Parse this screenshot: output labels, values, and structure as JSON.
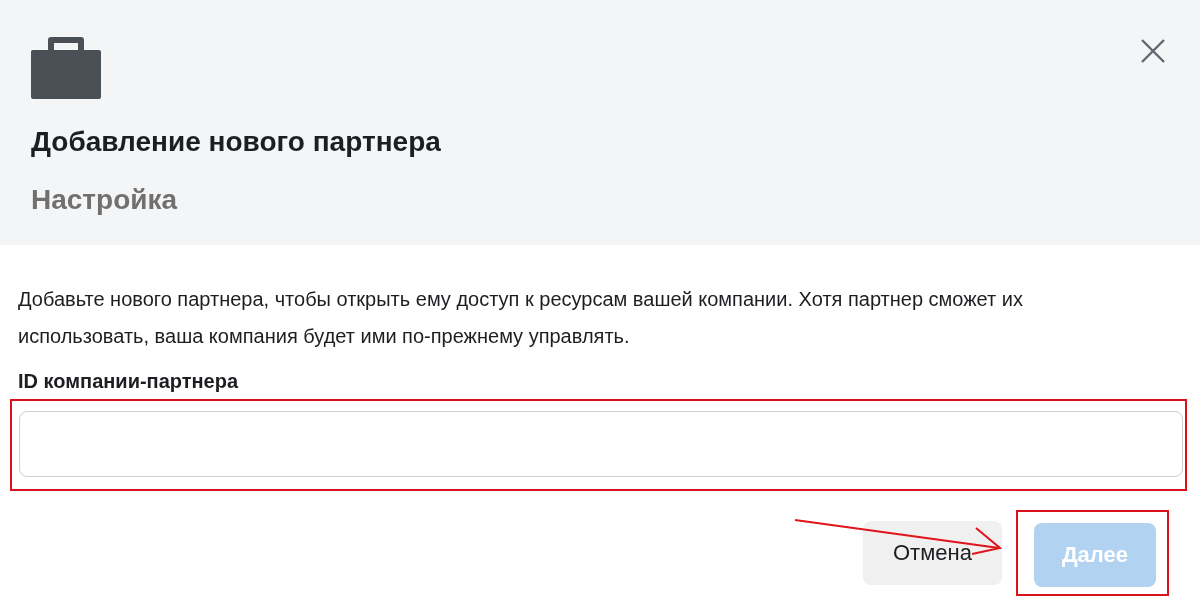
{
  "dialog": {
    "title": "Добавление нового партнера",
    "subtitle": "Настройка"
  },
  "description": "Добавьте нового партнера, чтобы открыть ему доступ к ресурсам вашей компании. Хотя партнер сможет их использовать, ваша компания будет ими по-прежнему управлять.",
  "field": {
    "label": "ID компании-партнера",
    "highlighted": true
  },
  "buttons": [
    {
      "label": "Отмена",
      "kind": "secondary",
      "disabled": false,
      "highlighted": false
    },
    {
      "label": "Далее",
      "kind": "primary",
      "disabled": true,
      "highlighted": true
    }
  ]
}
